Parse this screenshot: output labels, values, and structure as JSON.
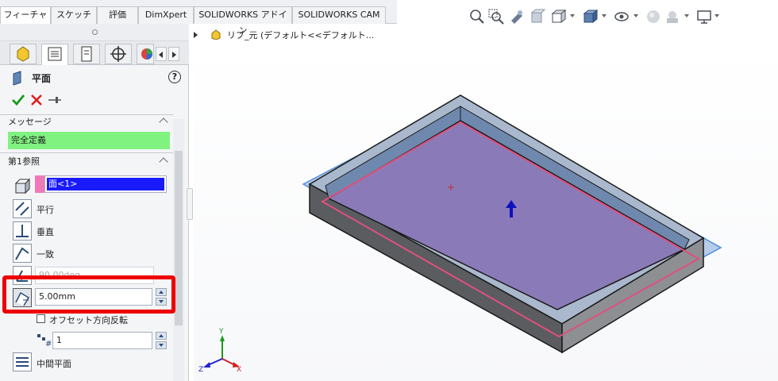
{
  "tabs": [
    "フィーチャー",
    "スケッチ",
    "評価",
    "DimXpert",
    "SOLIDWORKS アドイン",
    "SOLIDWORKS CAM"
  ],
  "tree_item": "リブ_元 (デフォルト<<デフォルト...",
  "panel": {
    "title": "平面",
    "help_glyph": "?",
    "message_header": "メッセージ",
    "message_text": "完全定義",
    "ref1_header": "第1参照",
    "ref_value": "面<1>",
    "options": {
      "parallel": "平行",
      "perpendicular": "垂直",
      "coincident": "一致"
    },
    "angle_value": "90.00deg",
    "offset_value": "5.00mm",
    "flip_label": "オフセット方向反転",
    "count_value": "1",
    "mid_plane": "中間平面"
  },
  "triad": {
    "x": "X",
    "y": "Y",
    "z": "Z"
  },
  "colors": {
    "message_bg": "#80f280",
    "selection_bg": "#1a1aff",
    "plane_fill": "#8a7bb8",
    "highlight": "#ee0000"
  },
  "icons": [
    "feature-manager-icon",
    "property-manager-icon",
    "configuration-manager-icon",
    "dimxpert-icon",
    "display-manager-icon",
    "zoom-to-fit-icon",
    "zoom-to-area-icon",
    "previous-view-icon",
    "section-view-icon",
    "view-orientation-icon",
    "display-style-icon",
    "hide-show-icon",
    "appearance-icon",
    "scene-icon",
    "display-settings-icon"
  ]
}
